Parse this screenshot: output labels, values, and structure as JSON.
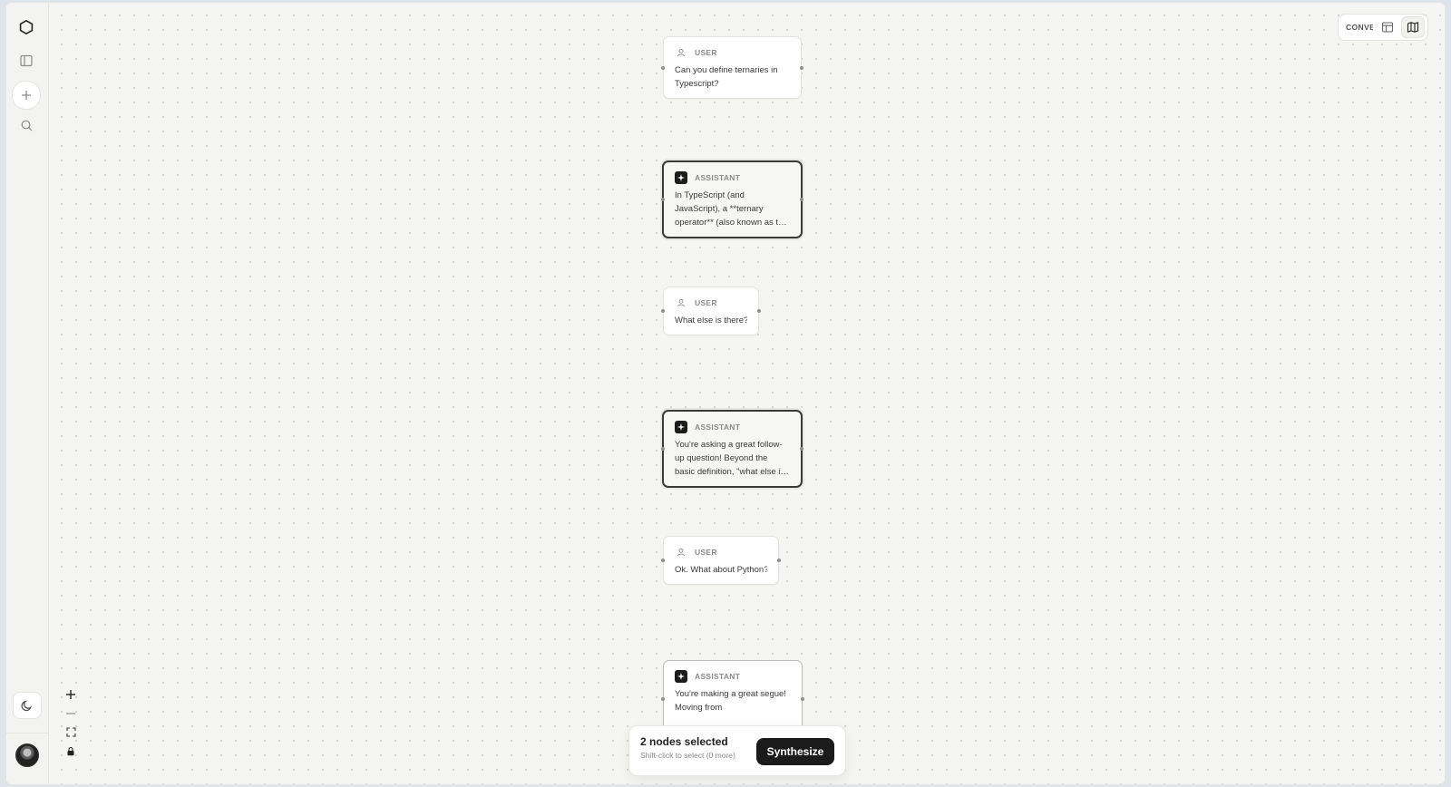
{
  "top_bar": {
    "conversation_label": "CONVERSATION"
  },
  "nodes": [
    {
      "role": "USER",
      "text": "Can you define ternaries in Typescript?"
    },
    {
      "role": "ASSISTANT",
      "text": "In TypeScript (and JavaScript), a **ternary operator** (also known as the conditional operator) is a concise way to write an if-else statement."
    },
    {
      "role": "USER",
      "text": "What else is there?"
    },
    {
      "role": "ASSISTANT",
      "text": "You're asking a great follow-up question! Beyond the basic definition, \"what else is there\" to know about ternaries?"
    },
    {
      "role": "USER",
      "text": "Ok. What about Python?"
    },
    {
      "role": "ASSISTANT",
      "text": "You're making a great segue! Moving from"
    }
  ],
  "selection": {
    "title": "2 nodes selected",
    "hint": "Shift-click to select (0 more)",
    "action_label": "Synthesize"
  },
  "colors": {
    "canvas_bg": "#f5f5f3",
    "accent_dark": "#1b1b1b",
    "grid_dot": "#cfcfcc"
  }
}
